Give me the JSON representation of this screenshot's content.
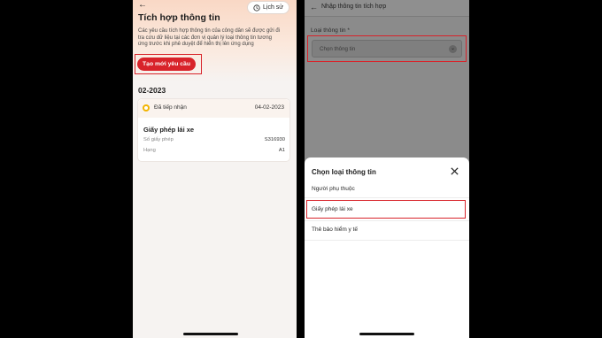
{
  "left": {
    "title": "Tích hợp thông tin",
    "history_label": "Lịch sử",
    "description_lines": [
      "Các yêu cầu tích hợp thông tin của công dân sẽ được gửi đi",
      "tra cứu dữ liệu tại các đơn vị quản lý loại thông tin tương",
      "ứng trước khi phê duyệt để hiển thị lên ứng dụng"
    ],
    "create_button": "Tạo mới yêu cầu",
    "section_date": "02-2023",
    "card": {
      "status": "Đã tiếp nhận",
      "date": "04-02-2023",
      "doc_name": "Giấy phép lái xe",
      "rows": [
        {
          "label": "Số giấy phép",
          "value": "S316930"
        },
        {
          "label": "Hạng",
          "value": "A1"
        }
      ]
    }
  },
  "right": {
    "title": "Nhập thông tin tích hợp",
    "field_label": "Loại thông tin *",
    "field_placeholder": "Chọn thông tin",
    "sheet": {
      "title": "Chọn loại thông tin",
      "options": [
        "Người phụ thuộc",
        "Giấy phép lái xe",
        "Thẻ bảo hiểm y tế"
      ]
    }
  },
  "colors": {
    "accent_red": "#d8232a",
    "status_yellow": "#f2b400",
    "overlay_gray": "#8b8b8b"
  },
  "icons": {
    "back": "arrow-left-icon",
    "history": "clock-icon",
    "status": "status-dot-icon",
    "dropdown": "chevron-down-icon",
    "close": "close-icon"
  }
}
